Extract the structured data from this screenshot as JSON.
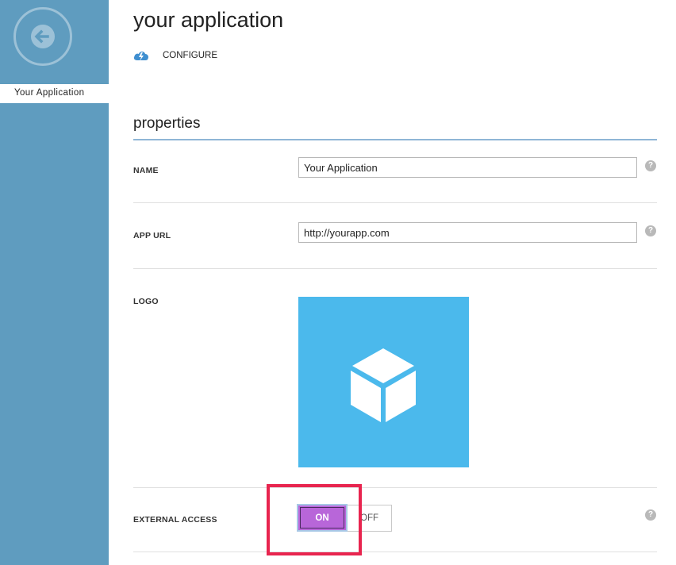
{
  "sidebar": {
    "back_icon": "arrow-left-icon",
    "items": [
      {
        "label": "Your Application"
      }
    ],
    "background": "#5f9cbf"
  },
  "header": {
    "title": "your application",
    "tab": {
      "label": "CONFIGURE",
      "icon": "cloud-lightning-icon"
    }
  },
  "section": {
    "title": "properties"
  },
  "fields": {
    "name": {
      "label": "NAME",
      "value": "Your Application"
    },
    "app_url": {
      "label": "APP URL",
      "value": "http://yourapp.com"
    },
    "logo": {
      "label": "LOGO",
      "icon": "cube-icon",
      "color": "#4bb9ec"
    },
    "external_access": {
      "label": "EXTERNAL ACCESS",
      "on_label": "ON",
      "off_label": "OFF",
      "selected": "ON",
      "on_color": "#b866d9"
    }
  },
  "help": {
    "glyph": "?"
  },
  "annotation": {
    "color": "#e8254f"
  }
}
